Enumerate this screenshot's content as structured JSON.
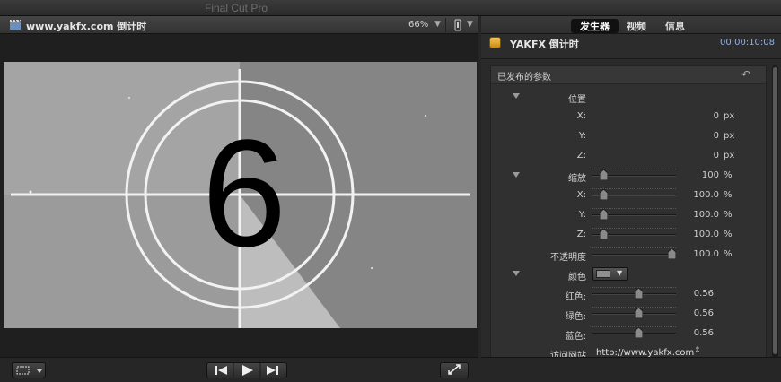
{
  "window": {
    "title": "Final Cut Pro"
  },
  "viewer": {
    "title": "www.yakfx.com 倒计时",
    "zoom": "66%",
    "countdown_digit": "6"
  },
  "inspector": {
    "tabs": [
      {
        "label": "发生器",
        "active": true
      },
      {
        "label": "视频",
        "active": false
      },
      {
        "label": "信息",
        "active": false
      }
    ],
    "generator_name": "YAKFX 倒计时",
    "timecode": "00:00:10:08",
    "section_title": "已发布的参数",
    "rows": [
      {
        "type": "group",
        "label": "位置"
      },
      {
        "type": "num",
        "label": "X:",
        "value": "0",
        "unit": "px"
      },
      {
        "type": "num",
        "label": "Y:",
        "value": "0",
        "unit": "px"
      },
      {
        "type": "num",
        "label": "Z:",
        "value": "0",
        "unit": "px"
      },
      {
        "type": "group_slider",
        "label": "缩放",
        "value": "100",
        "unit": "%",
        "level": 0.1
      },
      {
        "type": "slider",
        "label": "X:",
        "value": "100.0",
        "unit": "%",
        "level": 0.1
      },
      {
        "type": "slider",
        "label": "Y:",
        "value": "100.0",
        "unit": "%",
        "level": 0.1
      },
      {
        "type": "slider",
        "label": "Z:",
        "value": "100.0",
        "unit": "%",
        "level": 0.1
      },
      {
        "type": "slider",
        "label": "不透明度",
        "value": "100.0",
        "unit": "%",
        "level": 1.0
      },
      {
        "type": "group_color",
        "label": "颜色",
        "swatch": "#8f8f8f"
      },
      {
        "type": "slider",
        "label": "红色:",
        "value": "0.56",
        "unit": "",
        "level": 0.56
      },
      {
        "type": "slider",
        "label": "绿色:",
        "value": "0.56",
        "unit": "",
        "level": 0.56
      },
      {
        "type": "slider",
        "label": "蓝色:",
        "value": "0.56",
        "unit": "",
        "level": 0.56
      },
      {
        "type": "popup",
        "label": "访问网站",
        "value": "http://www.yakfx.com"
      }
    ]
  },
  "colors": {
    "accent": "#7fb0ff",
    "panel": "#2a2a2a"
  }
}
